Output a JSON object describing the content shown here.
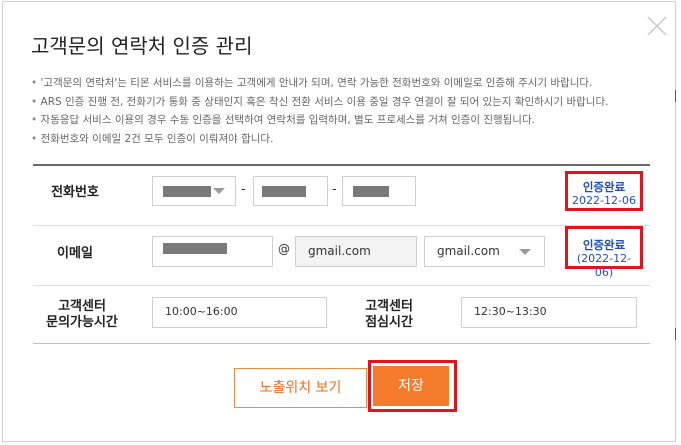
{
  "dialog": {
    "title": "고객문의 연락처 인증 관리",
    "notices": [
      "'고객문의 연락처'는 티몬 서비스를 이용하는 고객에게 안내가 되며, 연락 가능한 전화번호와 이메일로 인증해 주시기 바랍니다.",
      "ARS 인증 진행 전, 전화기가 통화 중 상태인지 혹은 착신 전환 서비스 이용 중일 경우 연결이 잘 되어 있는지 확인하시기 바랍니다.",
      "자동응답 서비스 이용의 경우 수동 인증을 선택하여 연락처를 입력하며, 별도 프로세스를 거쳐 인증이 진행됩니다.",
      "전화번호와 이메일 2건 모두 인증이 이뤄져야 합니다."
    ]
  },
  "phone": {
    "label": "전화번호",
    "separator": "-",
    "status": "인증완료",
    "date": "2022-12-06"
  },
  "email": {
    "label": "이메일",
    "at": "@",
    "domain_value": "gmail.com",
    "domain_select": "gmail.com",
    "status": "인증완료",
    "date": "(2022-12-06)"
  },
  "hours": {
    "inquiry_label_line1": "고객센터",
    "inquiry_label_line2": "문의가능시간",
    "inquiry_value": "10:00~16:00",
    "lunch_label_line1": "고객센터",
    "lunch_label_line2": "점심시간",
    "lunch_value": "12:30~13:30"
  },
  "buttons": {
    "preview": "노출위치 보기",
    "save": "저장"
  },
  "colors": {
    "accent": "#f47b2b",
    "highlight": "#e0141b",
    "verified": "#1f4fbf"
  },
  "icons": {
    "close": "close-icon",
    "dropdown": "chevron-down-icon"
  }
}
